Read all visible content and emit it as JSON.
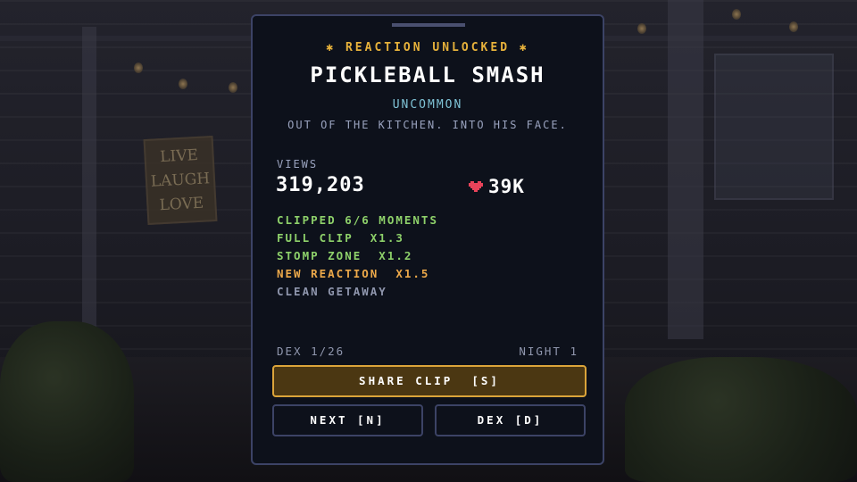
{
  "background": {
    "sign_lines": [
      "LIVE",
      "LAUGH",
      "LOVE"
    ]
  },
  "card": {
    "header": "✱ REACTION UNLOCKED ✱",
    "title": "PICKLEBALL SMASH",
    "rarity": "UNCOMMON",
    "tagline": "OUT OF THE KITCHEN. INTO HIS FACE."
  },
  "stats": {
    "views_label": "VIEWS",
    "views_value": "319,203",
    "likes_icon": "heart-icon",
    "likes_value": "39K"
  },
  "bonuses": [
    {
      "text": "CLIPPED 6/6 MOMENTS",
      "status": "green"
    },
    {
      "text": "FULL CLIP  X1.3",
      "status": "green"
    },
    {
      "text": "STOMP ZONE  X1.2",
      "status": "green"
    },
    {
      "text": "NEW REACTION  X1.5",
      "status": "orange"
    },
    {
      "text": "CLEAN GETAWAY",
      "status": "grey"
    }
  ],
  "footer": {
    "dex_progress": "DEX 1/26",
    "night": "NIGHT 1"
  },
  "buttons": {
    "share": "SHARE CLIP  [S]",
    "next": "NEXT [N]",
    "dex": "DEX [D]"
  },
  "colors": {
    "accent_gold": "#e7b23b",
    "rarity_cyan": "#7fc3d6",
    "bonus_green": "#8ed16a",
    "bonus_orange": "#eda94a",
    "heart_red": "#e8435a",
    "panel_bg": "#0d111b"
  }
}
